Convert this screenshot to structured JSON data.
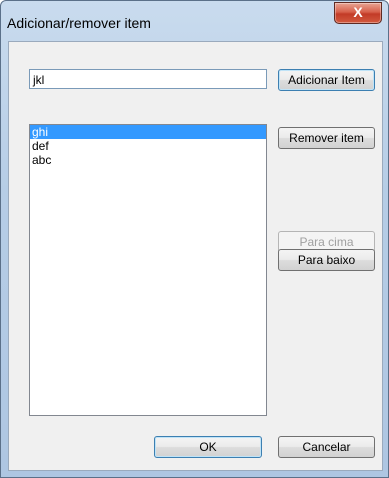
{
  "window": {
    "title": "Adicionar/remover  item",
    "close_glyph": "X"
  },
  "input": {
    "value": "jkl"
  },
  "list": {
    "items": [
      {
        "label": "ghi",
        "selected": true
      },
      {
        "label": "def",
        "selected": false
      },
      {
        "label": "abc",
        "selected": false
      }
    ]
  },
  "buttons": {
    "add": "Adicionar Item",
    "remove": "Remover  item",
    "up": "Para cima",
    "down": "Para baixo",
    "ok": "OK",
    "cancel": "Cancelar"
  },
  "colors": {
    "selection": "#3399ff",
    "close_button": "#c23b27"
  }
}
